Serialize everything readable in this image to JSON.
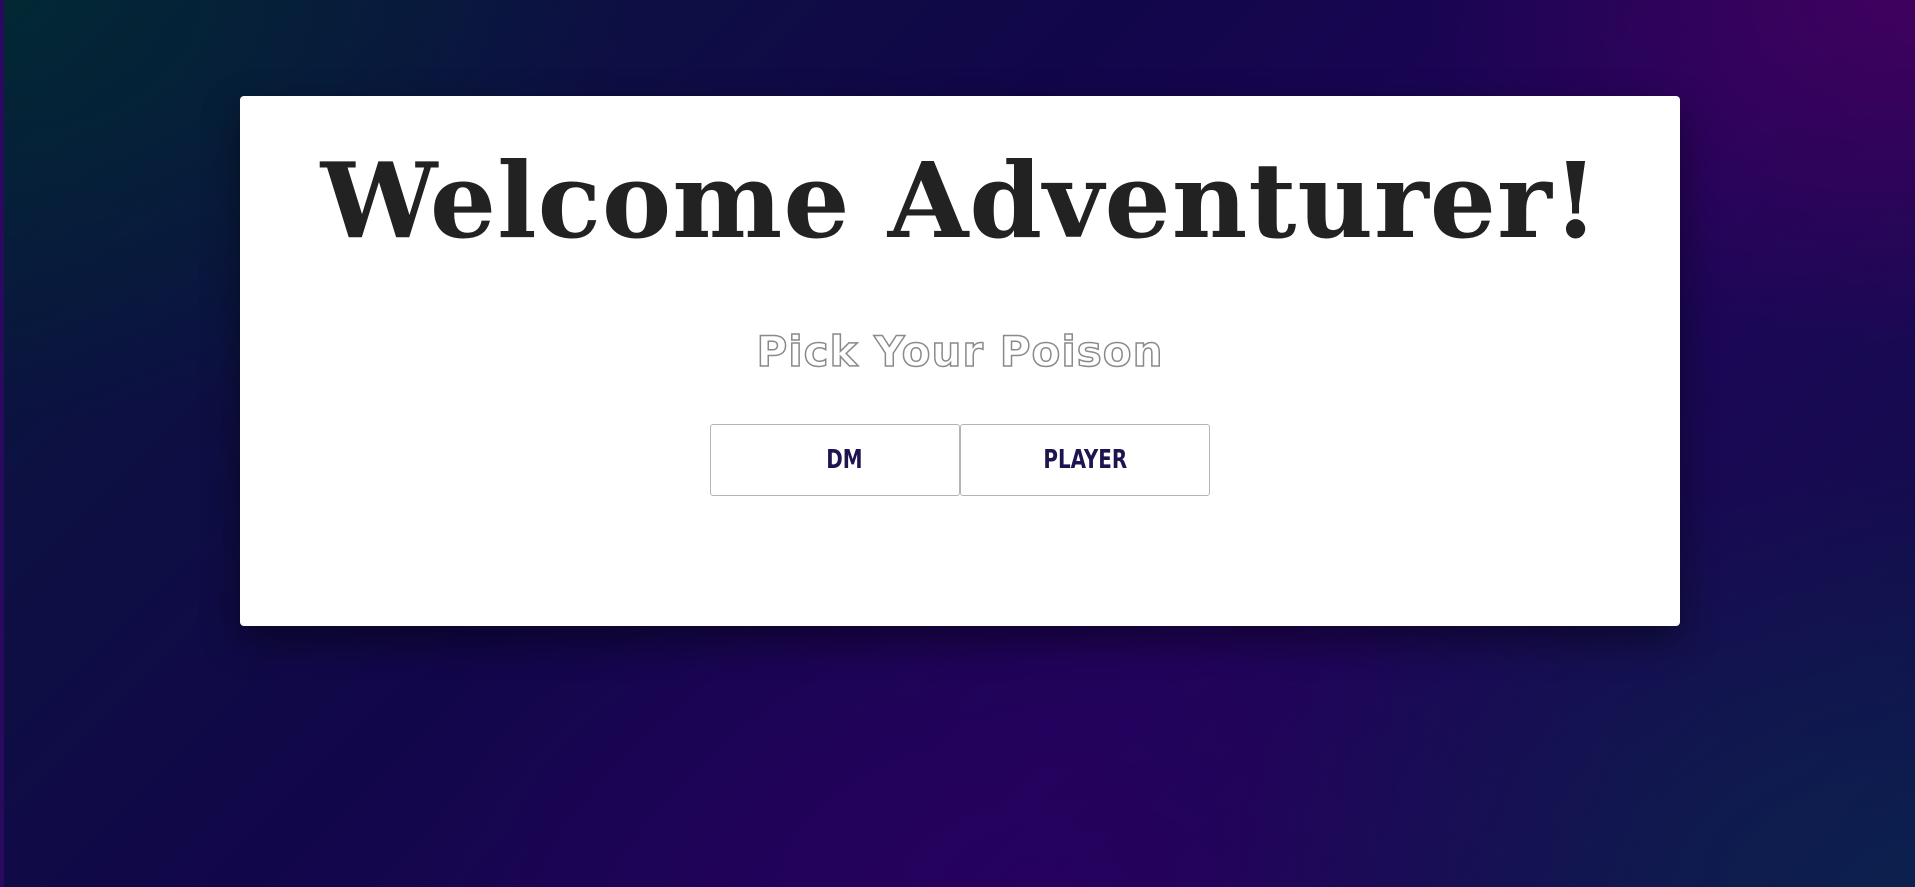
{
  "welcome": {
    "title": "Welcome Adventurer!",
    "subtitle": "Pick Your Poison",
    "buttons": {
      "dm_label": "DM",
      "player_label": "PLAYER"
    }
  },
  "colors": {
    "card_background": "#ffffff",
    "title_text": "#222222",
    "button_text": "#1d1550",
    "button_border": "#b4b4b4",
    "page_background_start": "#071a3a",
    "page_background_mid": "#1f045a",
    "page_background_end": "#0f1048"
  }
}
